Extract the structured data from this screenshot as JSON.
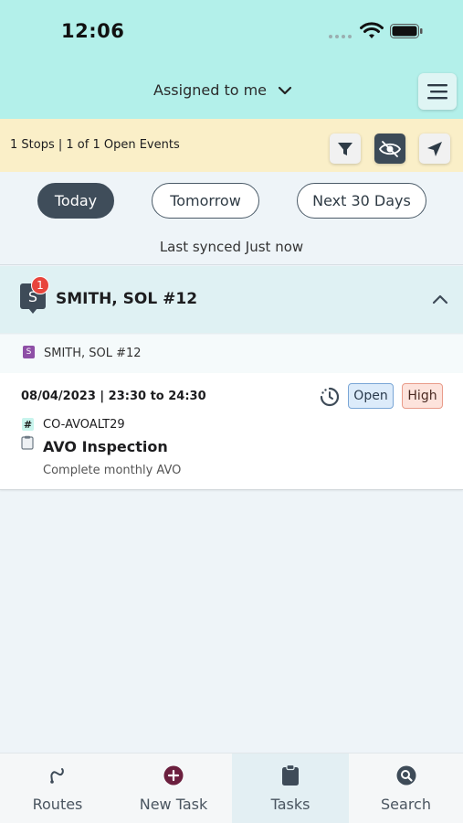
{
  "status_bar": {
    "time": "12:06"
  },
  "header": {
    "assigned_label": "Assigned to me"
  },
  "info_bar": {
    "stops_text": "1 Stops | 1 of 1 Open Events"
  },
  "date_filters": {
    "items": [
      {
        "label": "Today",
        "selected": true
      },
      {
        "label": "Tomorrow",
        "selected": false
      },
      {
        "label": "Next 30 Days",
        "selected": false
      }
    ],
    "sync_text": "Last synced Just now"
  },
  "stop": {
    "avatar_letter": "S",
    "badge_count": "1",
    "name": "SMITH, SOL #12",
    "sub_letter": "S",
    "sub_name": "SMITH, SOL #12"
  },
  "task": {
    "datetime": "08/04/2023 | 23:30 to 24:30",
    "status": "Open",
    "priority": "High",
    "code": "CO-AVOALT29",
    "title": "AVO Inspection",
    "description": "Complete monthly AVO"
  },
  "tabs": [
    {
      "label": "Routes",
      "icon": "routes-icon"
    },
    {
      "label": "New Task",
      "icon": "plus-circle-icon"
    },
    {
      "label": "Tasks",
      "icon": "clipboard-icon",
      "active": true
    },
    {
      "label": "Search",
      "icon": "search-icon"
    }
  ],
  "colors": {
    "header_bg": "#b3f0ea",
    "info_bar_bg": "#faefc8",
    "accent_dark": "#3f4d5a",
    "badge_red": "#e8453c",
    "new_task_icon": "#6b1f3e"
  }
}
